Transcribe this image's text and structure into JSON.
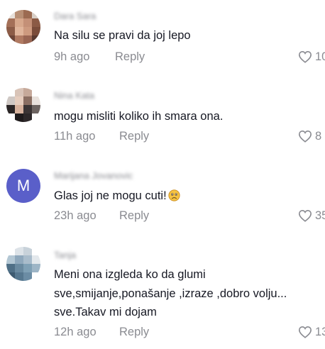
{
  "comments": [
    {
      "username": "Dara Sara",
      "text": "Na silu se pravi da joj lepo",
      "time": "9h ago",
      "reply_label": "Reply",
      "likes": "10"
    },
    {
      "username": "Nina Kata",
      "text": "mogu misliti koliko ih smara ona.",
      "time": "11h ago",
      "reply_label": "Reply",
      "likes": "8"
    },
    {
      "username": "Marijana Jovanovic",
      "avatar_letter": "M",
      "text": "Glas joj ne mogu cuti!",
      "emoji": "sad-face-emoji",
      "time": "23h ago",
      "reply_label": "Reply",
      "likes": "35"
    },
    {
      "username": "Tanja",
      "text_lines": [
        "Meni ona izgleda ko da glumi",
        "sve,smijanje,ponašanje ,izraze ,dobro volju...",
        "sve.Takav mi dojam"
      ],
      "time": "12h ago",
      "reply_label": "Reply",
      "likes": "13"
    }
  ],
  "colors": {
    "text": "#161823",
    "muted": "#8a8b91",
    "avatar_m": "#5a5fc9"
  }
}
